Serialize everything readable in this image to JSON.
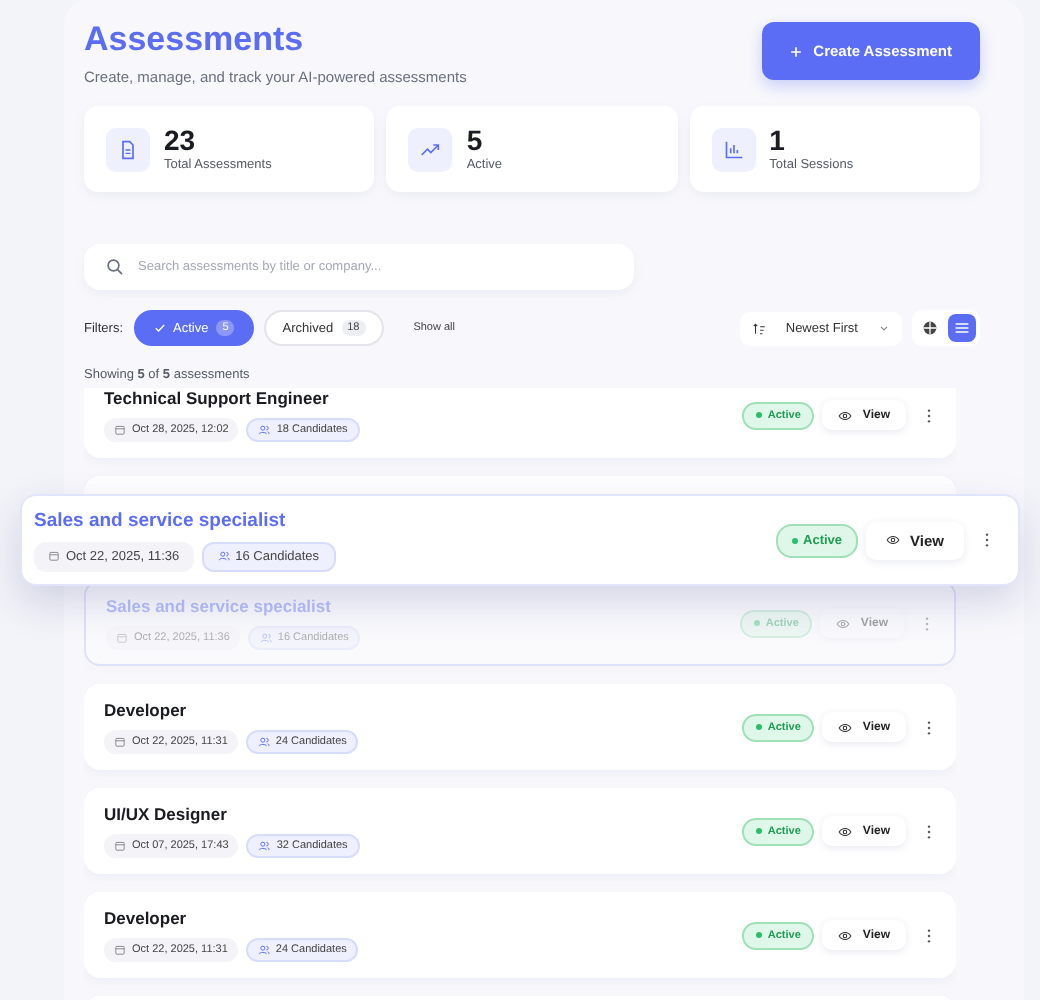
{
  "header": {
    "title": "Assessments",
    "subtitle": "Create, manage, and track your AI-powered assessments",
    "create_button": "Create Assessment"
  },
  "stats": [
    {
      "value": "23",
      "label": "Total Assessments"
    },
    {
      "value": "5",
      "label": "Active"
    },
    {
      "value": "1",
      "label": "Total Sessions"
    }
  ],
  "search": {
    "placeholder": "Search assessments by title or company..."
  },
  "filters": {
    "label": "Filters:",
    "chips": [
      {
        "label": "Active",
        "count": "5",
        "selected": true
      },
      {
        "label": "Archived",
        "count": "18",
        "selected": false
      }
    ],
    "show_all": "Show all"
  },
  "sort": {
    "label": "Newest First"
  },
  "view_toggle": [
    {
      "selected": false
    },
    {
      "selected": true
    }
  ],
  "showing": "Showing **5** of **5** assessments",
  "assessments": [
    {
      "kind": "card",
      "title": "Technical Support Engineer",
      "date": "Oct 28, 2025, 12:02",
      "candidates": "18 Candidates",
      "status": "Active",
      "action": "View"
    },
    {
      "kind": "slot"
    },
    {
      "kind": "dragging",
      "title": "Sales and service specialist",
      "date": "Oct 22, 2025, 11:36",
      "candidates": "16 Candidates",
      "status": "Active",
      "action": "View"
    },
    {
      "kind": "ghost",
      "title": "Sales and service specialist",
      "date": "Oct 22, 2025, 11:36",
      "candidates": "16 Candidates",
      "status": "Active",
      "action": "View"
    },
    {
      "kind": "card",
      "title": "Developer",
      "date": "Oct 22, 2025, 11:31",
      "candidates": "24 Candidates",
      "status": "Active",
      "action": "View"
    },
    {
      "kind": "card",
      "title": "UI/UX Designer",
      "date": "Oct 07, 2025, 17:43",
      "candidates": "32 Candidates",
      "status": "Active",
      "action": "View"
    },
    {
      "kind": "card",
      "title": "Developer",
      "date": "Oct 22, 2025, 11:31",
      "candidates": "24 Candidates",
      "status": "Active",
      "action": "View"
    },
    {
      "kind": "slot"
    }
  ]
}
